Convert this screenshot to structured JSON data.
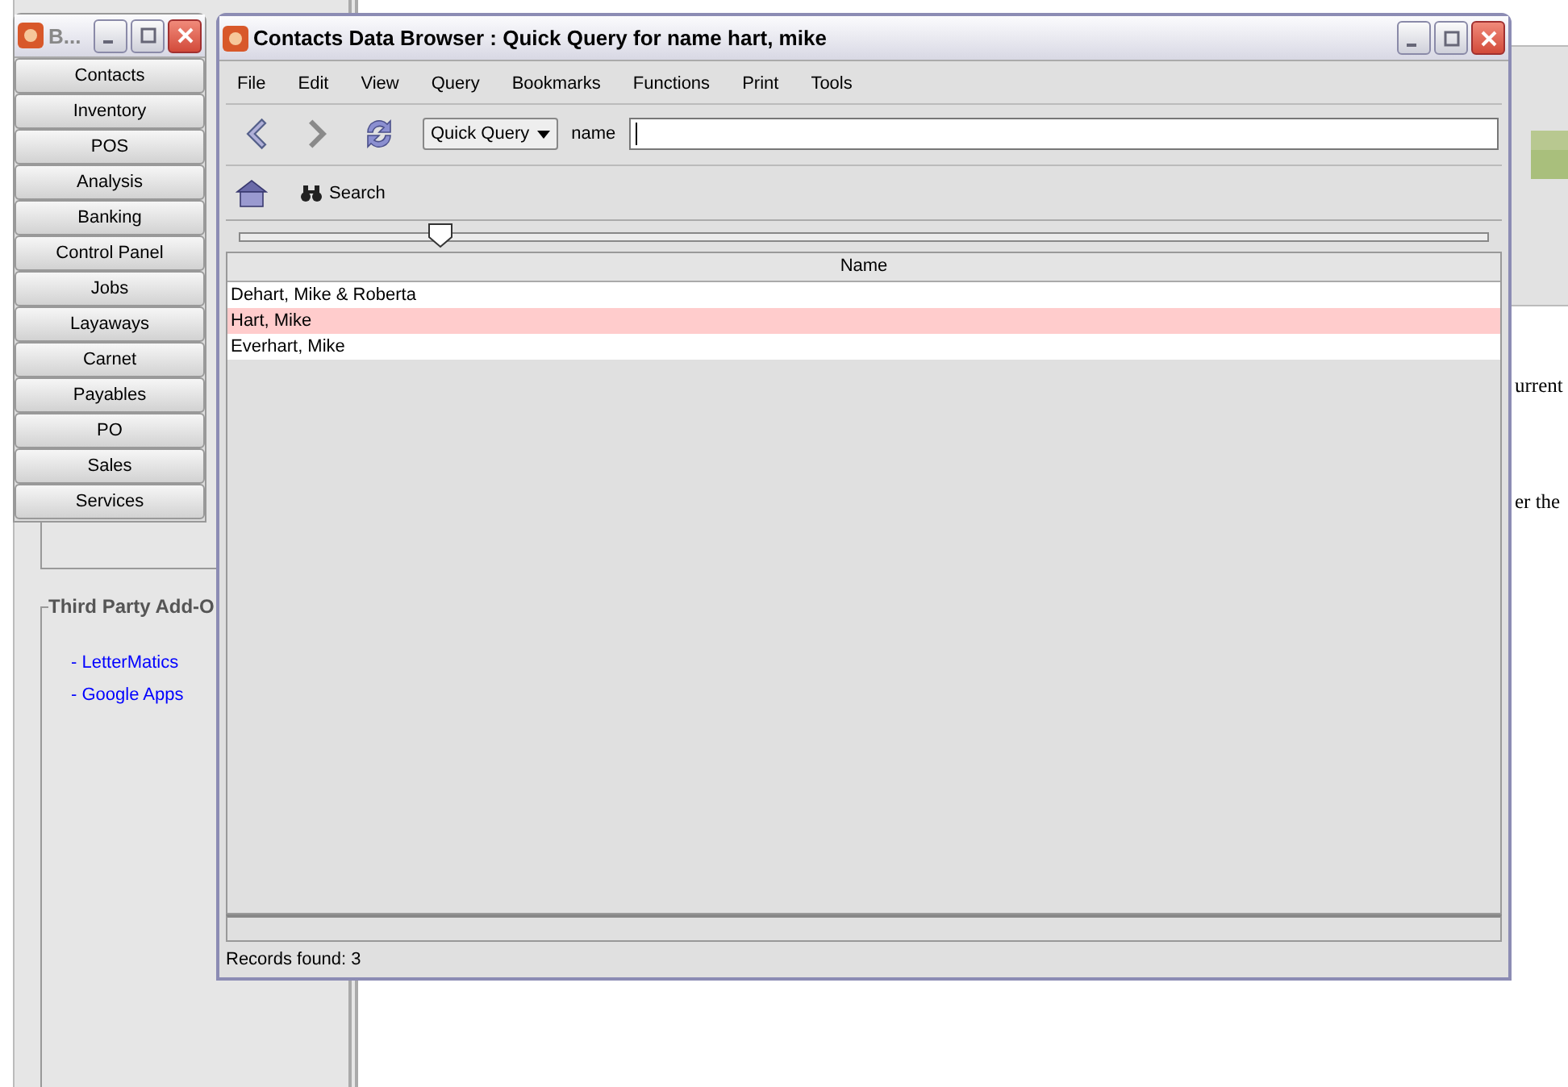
{
  "background_window": {
    "title": "B...",
    "nav_buttons": [
      "Contacts",
      "Inventory",
      "POS",
      "Analysis",
      "Banking",
      "Control Panel",
      "Jobs",
      "Layaways",
      "Carnet",
      "Payables",
      "PO",
      "Sales",
      "Services"
    ],
    "addons": {
      "title": "Third Party Add-O",
      "links": [
        "- LetterMatics",
        "- Google Apps"
      ]
    },
    "page_text": [
      "urrent",
      "er the"
    ]
  },
  "window": {
    "title": "Contacts Data Browser : Quick Query for name hart, mike"
  },
  "menu": [
    "File",
    "Edit",
    "View",
    "Query",
    "Bookmarks",
    "Functions",
    "Print",
    "Tools"
  ],
  "query": {
    "mode": "Quick Query",
    "field_label": "name"
  },
  "search_button": "Search",
  "slider": {
    "level": 0.16
  },
  "table": {
    "columns": [
      "Name"
    ],
    "rows": [
      {
        "name": "Dehart, Mike & Roberta",
        "selected": false
      },
      {
        "name": "Hart, Mike",
        "selected": true
      },
      {
        "name": "Everhart, Mike",
        "selected": false
      }
    ]
  },
  "status_bar": "Records found: 3"
}
